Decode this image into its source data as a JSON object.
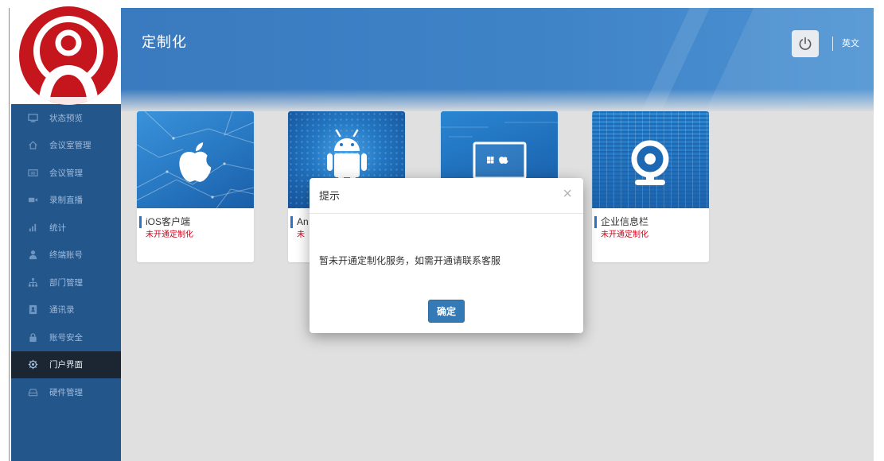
{
  "sidebar": {
    "avatar": {
      "icon": "user-avatar-icon"
    },
    "items": [
      {
        "label": "状态预览",
        "icon": "monitor-icon"
      },
      {
        "label": "会议室管理",
        "icon": "home-icon"
      },
      {
        "label": "会议管理",
        "icon": "id-card-icon"
      },
      {
        "label": "录制直播",
        "icon": "video-camera-icon"
      },
      {
        "label": "统计",
        "icon": "bar-chart-icon"
      },
      {
        "label": "终端账号",
        "icon": "user-icon"
      },
      {
        "label": "部门管理",
        "icon": "sitemap-icon"
      },
      {
        "label": "通讯录",
        "icon": "address-book-icon"
      },
      {
        "label": "账号安全",
        "icon": "lock-icon"
      },
      {
        "label": "门户界面",
        "icon": "gear-icon",
        "active": true
      },
      {
        "label": "硬件管理",
        "icon": "hdd-icon"
      }
    ]
  },
  "header": {
    "title": "定制化",
    "power_icon": "power-icon",
    "language_label": "英文"
  },
  "cards": [
    {
      "name": "iOS客户端",
      "status": "未开通定制化",
      "icon": "apple-icon"
    },
    {
      "name": "An",
      "status": "未",
      "icon": "android-icon"
    },
    {
      "icon": "monitor-windows-apple-icon"
    },
    {
      "name": "企业信息栏",
      "status": "未开通定制化",
      "icon": "webcam-icon"
    }
  ],
  "modal": {
    "title": "提示",
    "close_label": "×",
    "message": "暂未开通定制化服务，如需开通请联系客服",
    "confirm_label": "确定"
  },
  "colors": {
    "sidebar_bg": "#23578c",
    "sidebar_active_bg": "#1c2633",
    "header_blue": "#3a7abf",
    "page_bg": "#e0e0e0",
    "accent_blue": "#337ab7",
    "status_red": "#d0021b",
    "avatar_red": "#c5161e"
  }
}
